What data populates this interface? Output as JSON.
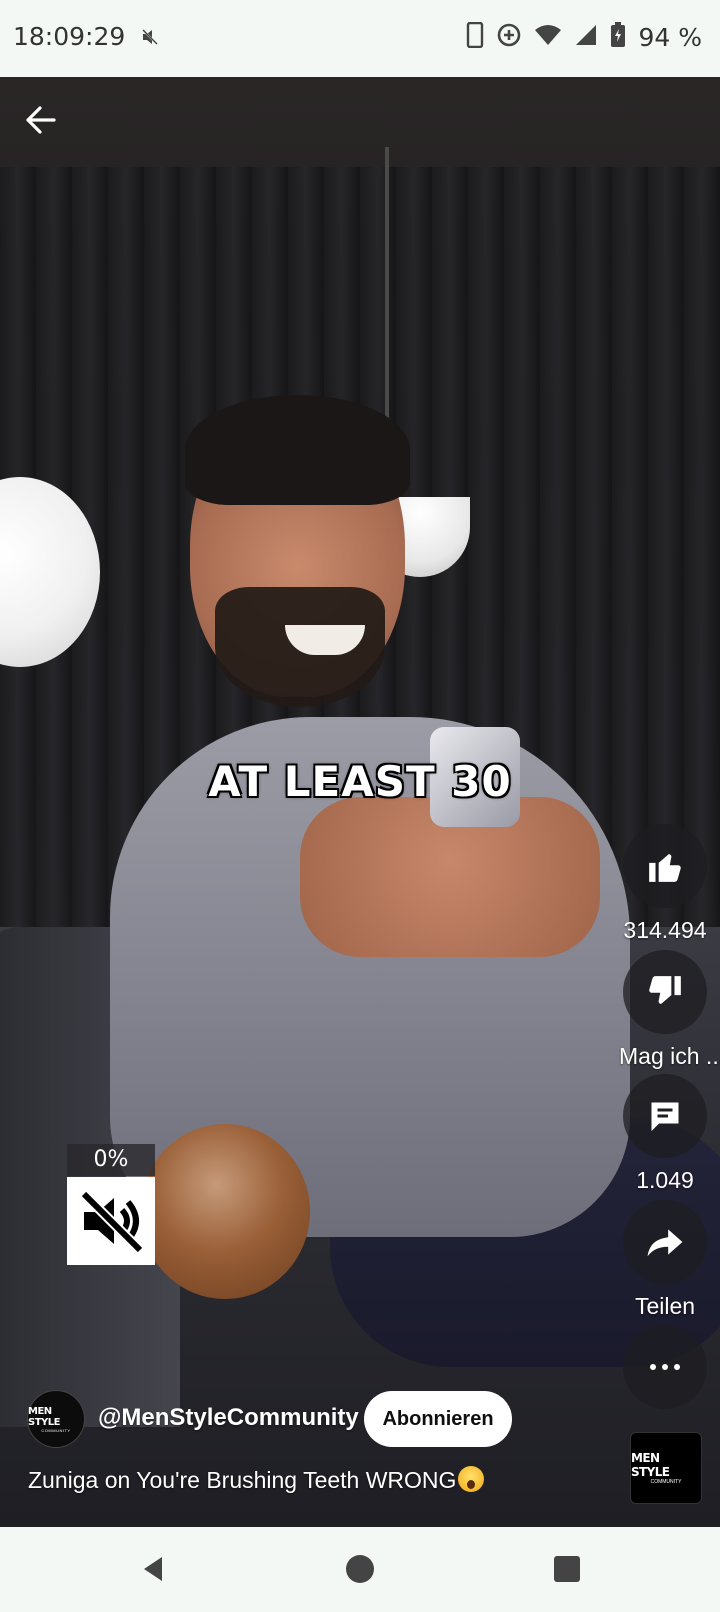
{
  "status_bar": {
    "time": "18:09:29",
    "battery_text": "94 %",
    "icons": [
      "mute-icon",
      "phone-icon",
      "data-saver-icon",
      "wifi-icon",
      "signal-icon",
      "battery-icon"
    ]
  },
  "video": {
    "caption": "AT LEAST 30",
    "volume_percent": "0%"
  },
  "actions": {
    "like_count": "314.494",
    "dislike_label": "Mag ich ...",
    "comment_count": "1.049",
    "share_label": "Teilen"
  },
  "channel": {
    "handle": "@MenStyleCommunity",
    "subscribe_label": "Abonnieren",
    "avatar_text": "MEN STYLE",
    "avatar_subtext": "COMMUNITY"
  },
  "video_title": "Zuniga on You're Brushing Teeth WRONG",
  "thumbnail": {
    "text": "MEN STYLE",
    "subtext": "COMMUNITY"
  },
  "colors": {
    "status_bg": "#f3f8f5",
    "subscribe_bg": "#ffffff",
    "action_bg": "#1e1e22"
  }
}
